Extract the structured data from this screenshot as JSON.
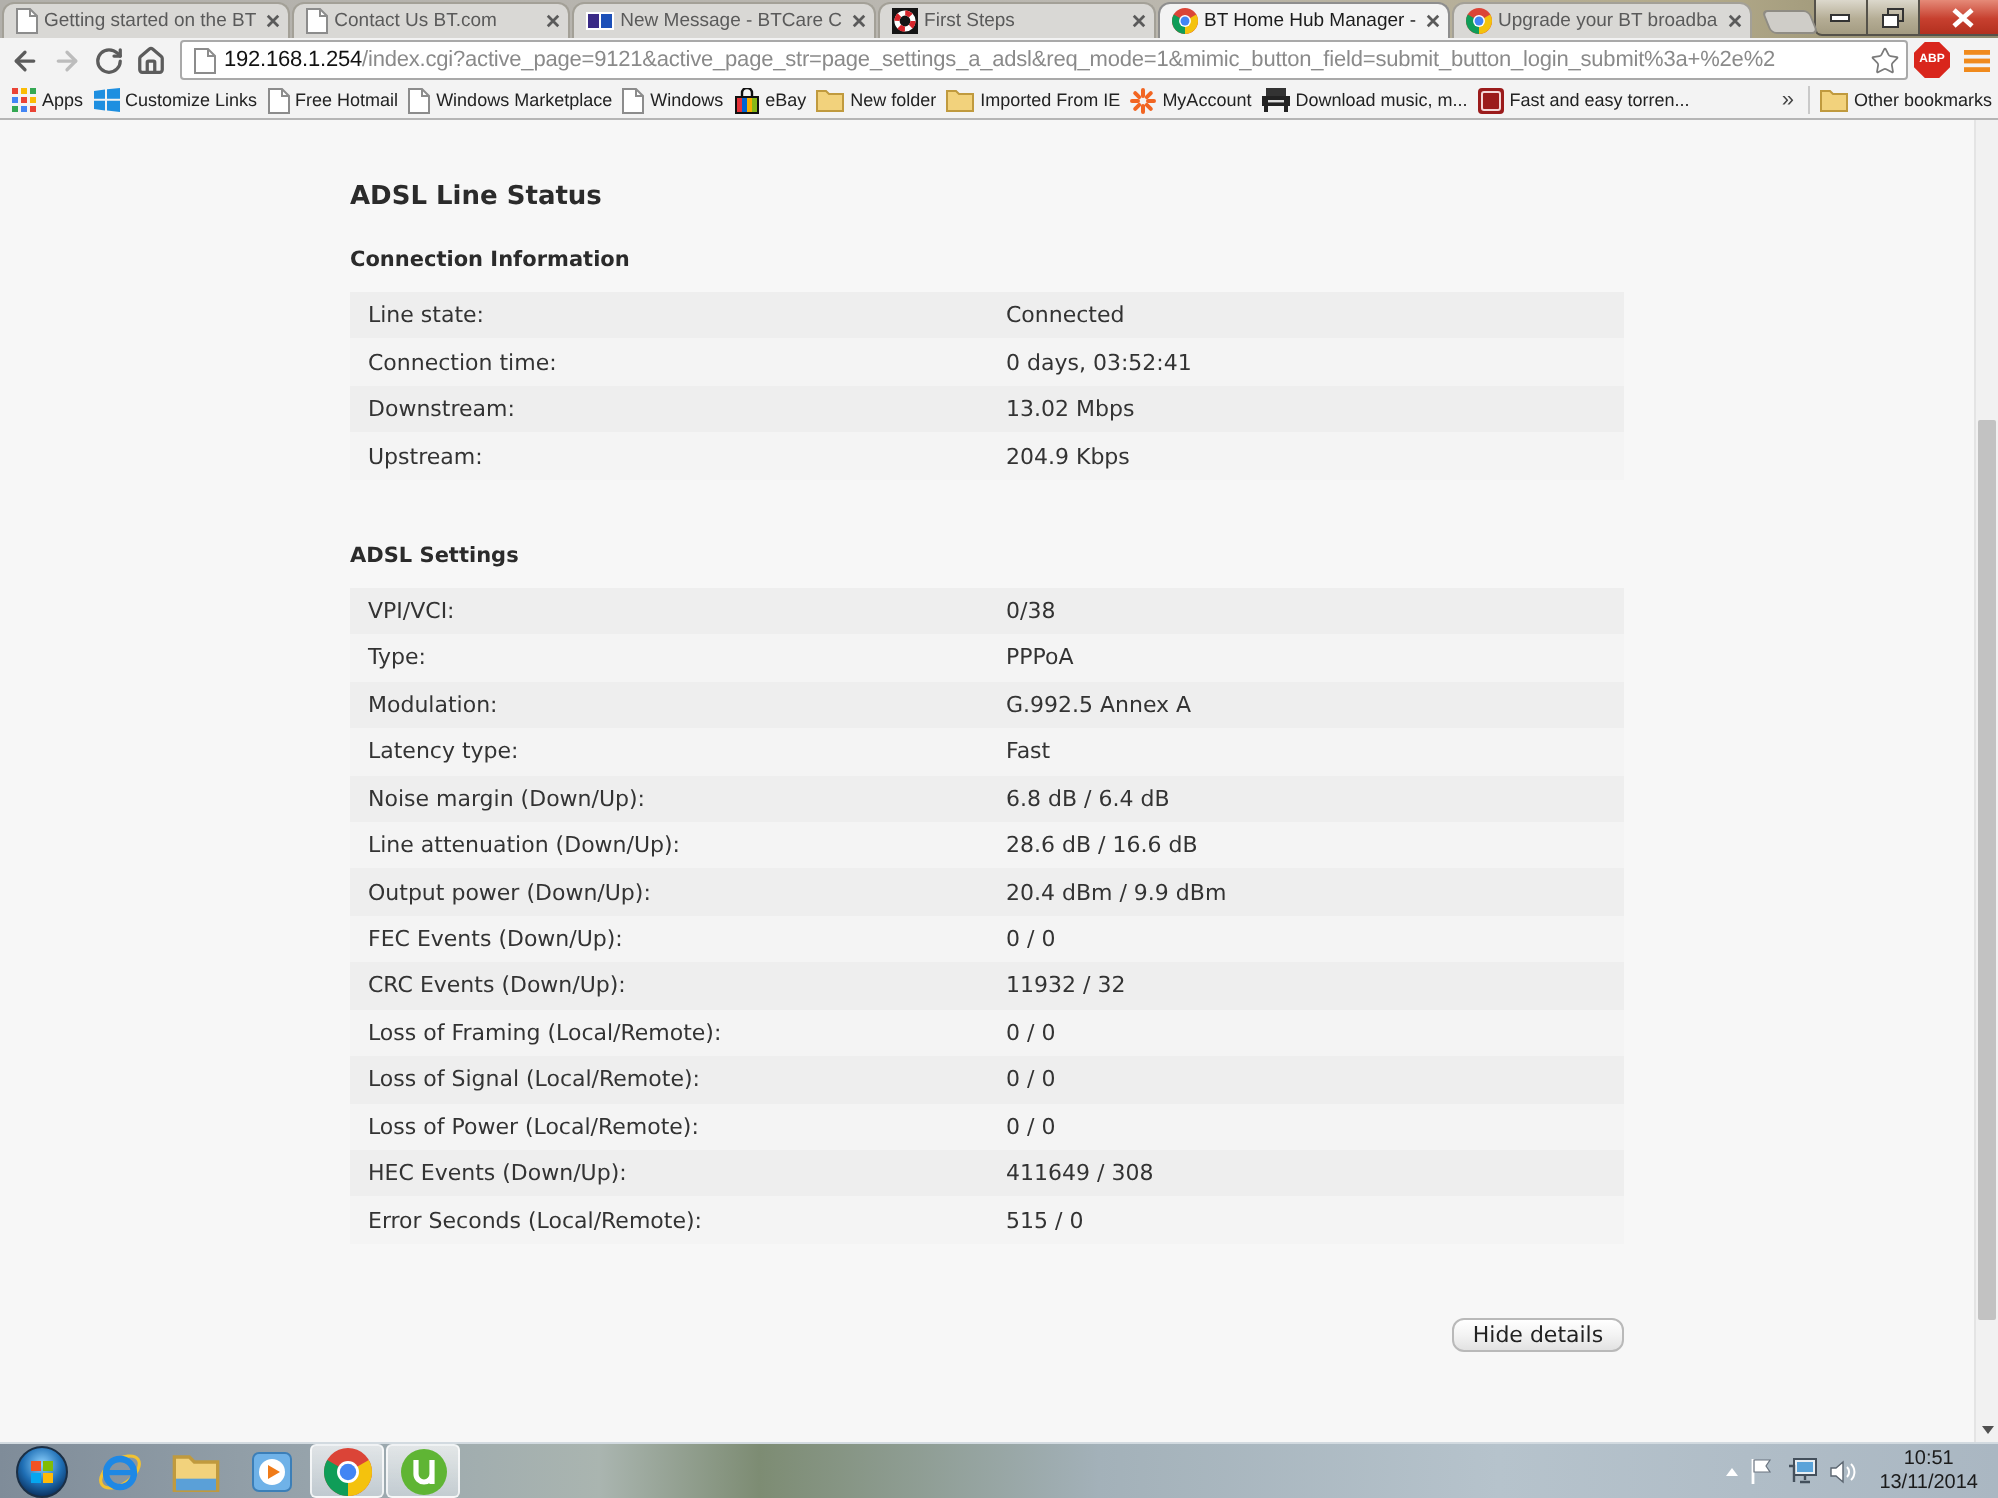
{
  "browser": {
    "tabs": [
      {
        "title": "Getting started on the BT",
        "kind": "page",
        "selected": false
      },
      {
        "title": "Contact Us BT.com",
        "kind": "page",
        "selected": false
      },
      {
        "title": "New Message - BTCare C",
        "kind": "bt",
        "selected": false
      },
      {
        "title": "First Steps",
        "kind": "lifebuoy",
        "selected": false
      },
      {
        "title": "BT Home Hub Manager -",
        "kind": "globe",
        "selected": true
      },
      {
        "title": "Upgrade your BT broadba",
        "kind": "globe",
        "selected": false
      }
    ],
    "toolbar": {
      "nav": [
        {
          "kind": "back",
          "disabled": false
        },
        {
          "kind": "forward",
          "disabled": true
        },
        {
          "kind": "reload",
          "disabled": false
        },
        {
          "kind": "home",
          "disabled": false
        }
      ],
      "address": {
        "host": "192.168.1.254",
        "path": "/index.cgi?active_page=9121&active_page_str=page_settings_a_adsl&req_mode=1&mimic_button_field=submit_button_login_submit%3a+%2e%2"
      },
      "bookmarked": false,
      "extension_label": "ABP"
    },
    "bookmarks": {
      "items": [
        {
          "label": "Apps",
          "kind": "apps"
        },
        {
          "label": "Customize Links",
          "kind": "windows"
        },
        {
          "label": "Free Hotmail",
          "kind": "page"
        },
        {
          "label": "Windows Marketplace",
          "kind": "page"
        },
        {
          "label": "Windows",
          "kind": "page"
        },
        {
          "label": "eBay",
          "kind": "ebay"
        },
        {
          "label": "New folder",
          "kind": "folder"
        },
        {
          "label": "Imported From IE",
          "kind": "folder"
        },
        {
          "label": "MyAccount",
          "kind": "myaccount"
        },
        {
          "label": "Download music, m...",
          "kind": "download"
        },
        {
          "label": "Fast and easy torren...",
          "kind": "torrent"
        }
      ],
      "overflow": "»",
      "other": "Other bookmarks"
    }
  },
  "page": {
    "title": "ADSL Line Status",
    "sections": [
      {
        "heading": "Connection Information",
        "rows": [
          {
            "label": "Line state:",
            "value": "Connected"
          },
          {
            "label": "Connection time:",
            "value": "0 days, 03:52:41"
          },
          {
            "label": "Downstream:",
            "value": "13.02 Mbps"
          },
          {
            "label": "Upstream:",
            "value": "204.9 Kbps"
          }
        ]
      },
      {
        "heading": "ADSL Settings",
        "rows": [
          {
            "label": "VPI/VCI:",
            "value": "0/38"
          },
          {
            "label": "Type:",
            "value": "PPPoA"
          },
          {
            "label": "Modulation:",
            "value": "G.992.5 Annex A"
          },
          {
            "label": "Latency type:",
            "value": "Fast"
          },
          {
            "label": "Noise margin (Down/Up):",
            "value": "6.8 dB / 6.4 dB"
          },
          {
            "label": "Line attenuation (Down/Up):",
            "value": "28.6 dB / 16.6 dB"
          },
          {
            "label": "Output power (Down/Up):",
            "value": "20.4 dBm / 9.9 dBm"
          },
          {
            "label": "FEC Events (Down/Up):",
            "value": "0 / 0"
          },
          {
            "label": "CRC Events (Down/Up):",
            "value": "11932 / 32"
          },
          {
            "label": "Loss of Framing (Local/Remote):",
            "value": "0 / 0"
          },
          {
            "label": "Loss of Signal (Local/Remote):",
            "value": "0 / 0"
          },
          {
            "label": "Loss of Power (Local/Remote):",
            "value": "0 / 0"
          },
          {
            "label": "HEC Events (Down/Up):",
            "value": "411649 / 308"
          },
          {
            "label": "Error Seconds (Local/Remote):",
            "value": "515 / 0"
          }
        ]
      }
    ],
    "button": "Hide details"
  },
  "taskbar": {
    "apps": [
      {
        "kind": "ie",
        "running": false
      },
      {
        "kind": "explorer",
        "running": false
      },
      {
        "kind": "media",
        "running": false
      },
      {
        "kind": "chrome",
        "running": true
      },
      {
        "kind": "utorrent",
        "running": true
      }
    ],
    "clock": {
      "time": "10:51",
      "date": "13/11/2014"
    }
  }
}
